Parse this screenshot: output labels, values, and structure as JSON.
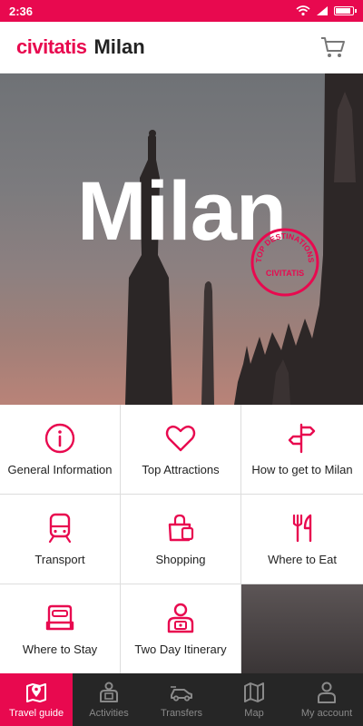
{
  "status": {
    "time": "2:36"
  },
  "header": {
    "brand": "civitatis",
    "city": "Milan"
  },
  "hero": {
    "title": "Milan",
    "badge_top": "TOP DESTINATIONS",
    "badge_bottom": "CIVITATIS"
  },
  "tiles": [
    {
      "label": "General Information",
      "icon": "info-icon"
    },
    {
      "label": "Top Attractions",
      "icon": "heart-icon"
    },
    {
      "label": "How to get to Milan",
      "icon": "signpost-icon"
    },
    {
      "label": "Transport",
      "icon": "train-icon"
    },
    {
      "label": "Shopping",
      "icon": "shopping-bag-icon"
    },
    {
      "label": "Where to Eat",
      "icon": "cutlery-icon"
    },
    {
      "label": "Where to Stay",
      "icon": "bed-icon"
    },
    {
      "label": "Two Day Itinerary",
      "icon": "itinerary-person-icon"
    }
  ],
  "nav": [
    {
      "label": "Travel guide",
      "icon": "map-pin-icon",
      "active": true
    },
    {
      "label": "Activities",
      "icon": "ticket-icon",
      "active": false
    },
    {
      "label": "Transfers",
      "icon": "car-icon",
      "active": false
    },
    {
      "label": "Map",
      "icon": "map-icon",
      "active": false
    },
    {
      "label": "My account",
      "icon": "person-icon",
      "active": false
    }
  ],
  "colors": {
    "accent": "#e8094f",
    "nav_bg": "#262626",
    "nav_inactive": "#8a8a8a"
  }
}
